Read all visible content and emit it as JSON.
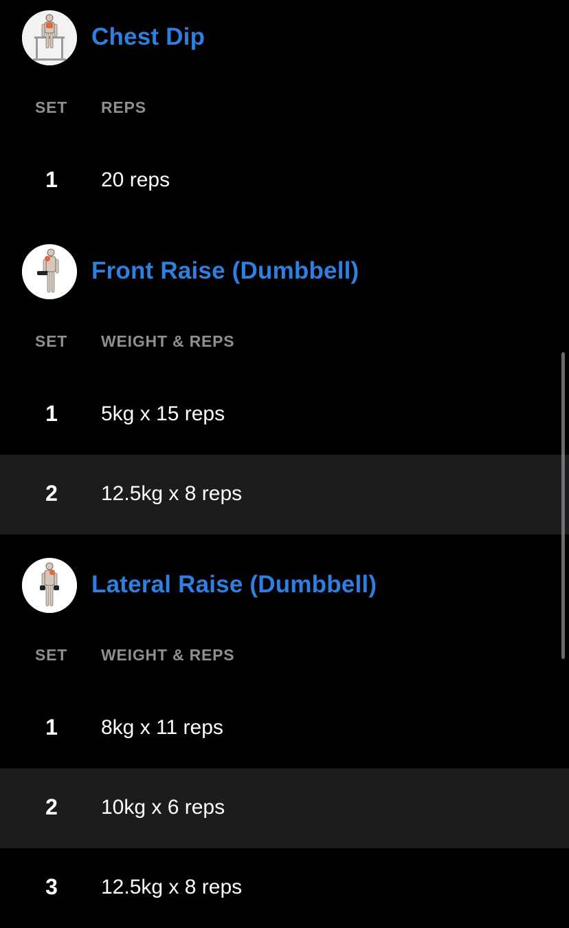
{
  "exercises": [
    {
      "title": "Chest Dip",
      "icon": "chest-dip-figure-icon",
      "col_set": "SET",
      "col_value": "REPS",
      "sets": [
        {
          "num": "1",
          "value": "20 reps"
        }
      ]
    },
    {
      "title": "Front Raise (Dumbbell)",
      "icon": "front-raise-figure-icon",
      "col_set": "SET",
      "col_value": "WEIGHT & REPS",
      "sets": [
        {
          "num": "1",
          "value": "5kg x 15 reps"
        },
        {
          "num": "2",
          "value": "12.5kg x 8 reps"
        }
      ]
    },
    {
      "title": "Lateral Raise (Dumbbell)",
      "icon": "lateral-raise-figure-icon",
      "col_set": "SET",
      "col_value": "WEIGHT & REPS",
      "sets": [
        {
          "num": "1",
          "value": "8kg x 11 reps"
        },
        {
          "num": "2",
          "value": "10kg x 6 reps"
        },
        {
          "num": "3",
          "value": "12.5kg x 8 reps"
        }
      ]
    }
  ],
  "colors": {
    "background": "#000000",
    "title_accent": "#2f7fe0",
    "header_gray": "#8e8e93",
    "alt_row": "#1c1c1e"
  }
}
